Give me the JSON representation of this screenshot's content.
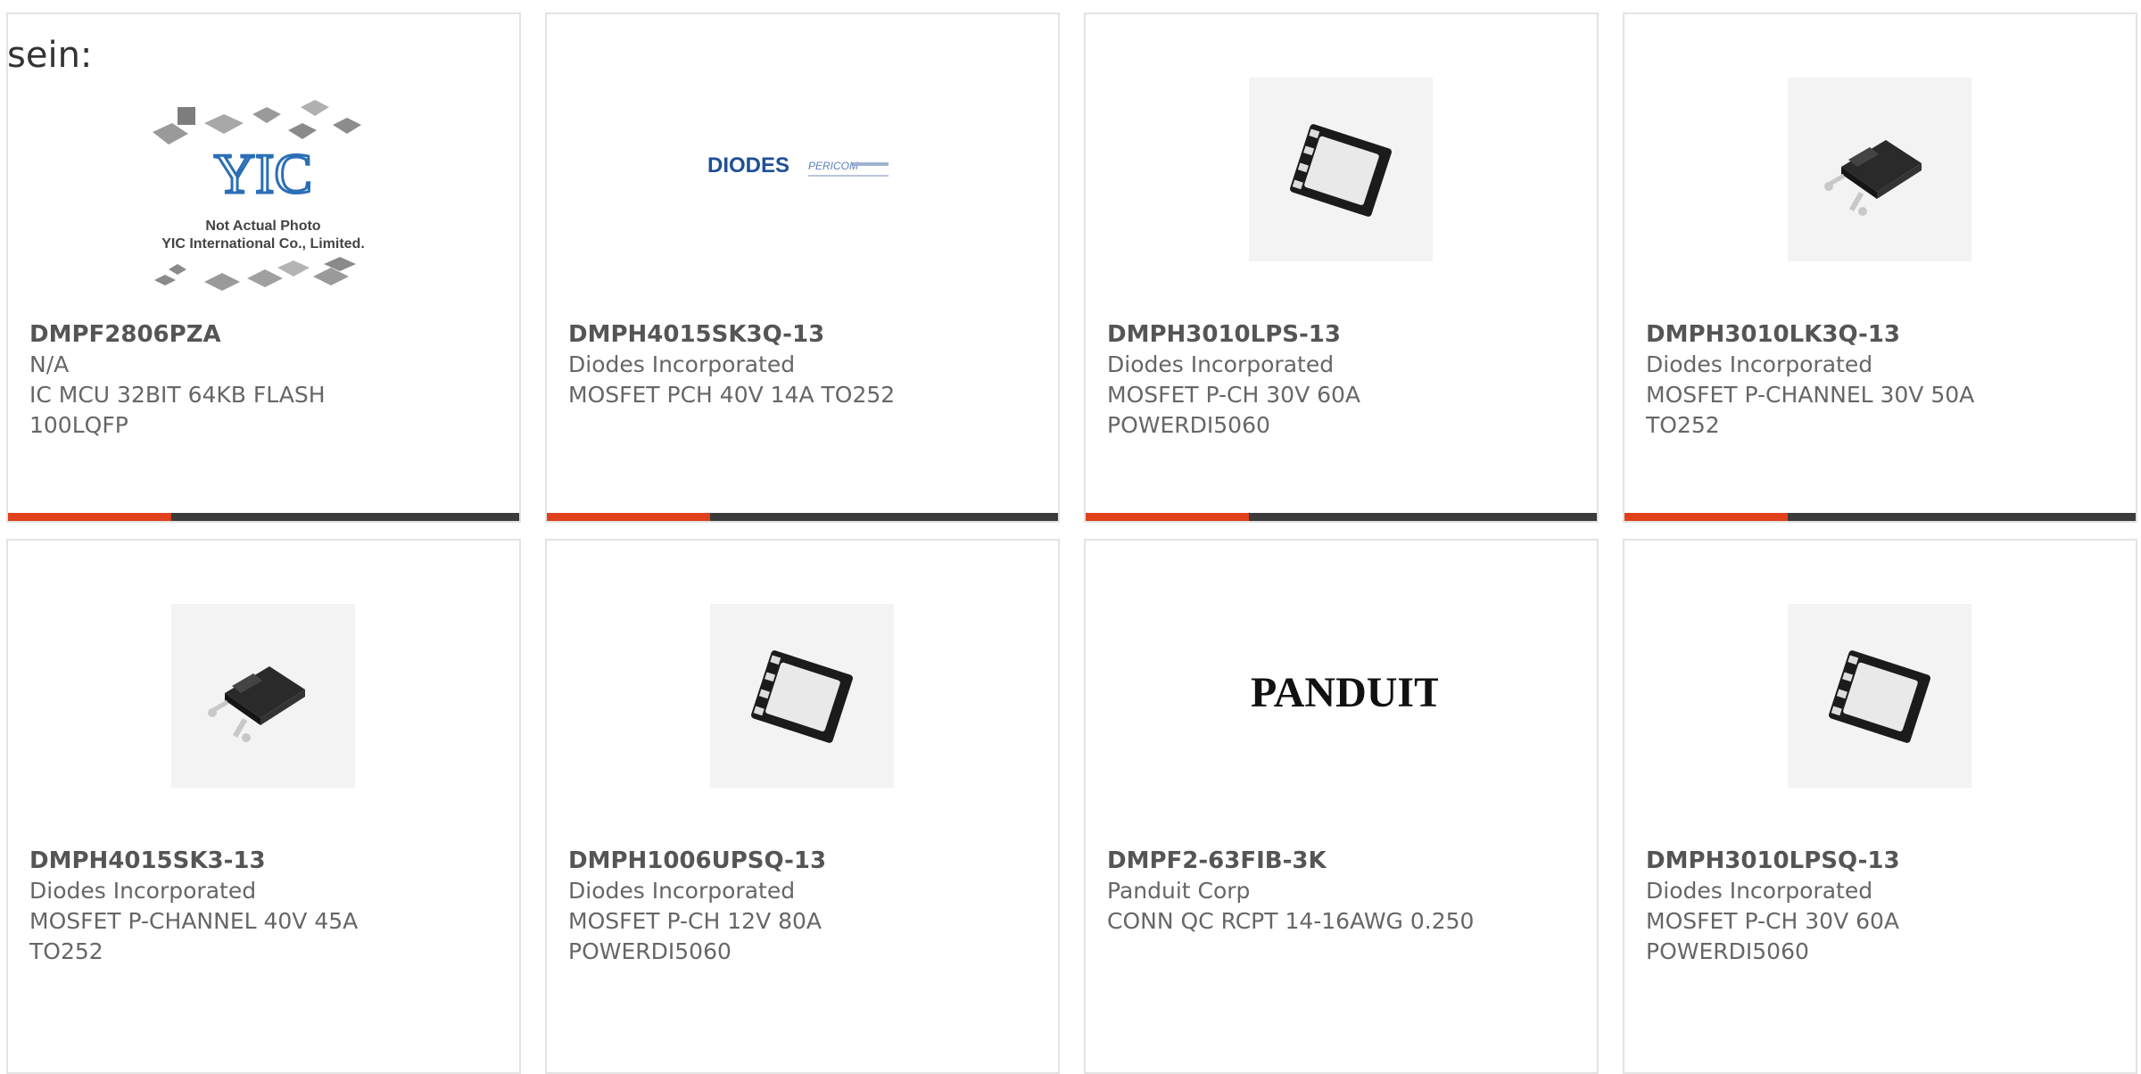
{
  "intro_text": "sein:",
  "accent_color": "#e0401c",
  "bar_color": "#3b3b3b",
  "products": [
    {
      "part": "DMPF2806PZA",
      "manufacturer": "N/A",
      "description": "IC MCU 32BIT 64KB FLASH\n100LQFP",
      "image": "placeholder-collage",
      "placeholder": {
        "logo": "YIC",
        "caption1": "Not Actual Photo",
        "caption2": "YIC International Co., Limited."
      }
    },
    {
      "part": "DMPH4015SK3Q-13",
      "manufacturer": "Diodes Incorporated",
      "description": "MOSFET PCH 40V 14A TO252",
      "image": "diodes-pericom-logo",
      "logo_text": "DIODES",
      "logo_subtext": "PERICOM"
    },
    {
      "part": "DMPH3010LPS-13",
      "manufacturer": "Diodes Incorporated",
      "description": "MOSFET P-CH 30V 60A\nPOWERDI5060",
      "image": "powerdi-package"
    },
    {
      "part": "DMPH3010LK3Q-13",
      "manufacturer": "Diodes Incorporated",
      "description": "MOSFET P-CHANNEL 30V 50A\nTO252",
      "image": "to252-package"
    },
    {
      "part": "DMPH4015SK3-13",
      "manufacturer": "Diodes Incorporated",
      "description": "MOSFET P-CHANNEL 40V 45A\nTO252",
      "image": "to252-package"
    },
    {
      "part": "DMPH1006UPSQ-13",
      "manufacturer": "Diodes Incorporated",
      "description": "MOSFET P-CH 12V 80A\nPOWERDI5060",
      "image": "powerdi-package"
    },
    {
      "part": "DMPF2-63FIB-3K",
      "manufacturer": "Panduit Corp",
      "description": "CONN QC RCPT 14-16AWG 0.250",
      "image": "panduit-logo",
      "logo_text": "PANDUIT"
    },
    {
      "part": "DMPH3010LPSQ-13",
      "manufacturer": "Diodes Incorporated",
      "description": "MOSFET P-CH 30V 60A\nPOWERDI5060",
      "image": "powerdi-package"
    }
  ]
}
